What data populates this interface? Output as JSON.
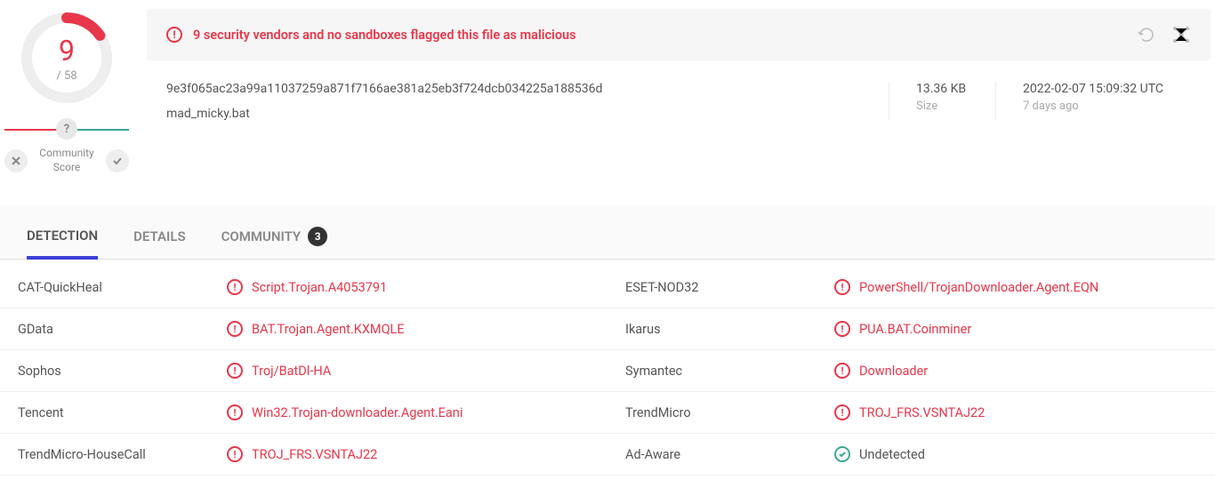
{
  "score": {
    "detections": "9",
    "total": "/ 58"
  },
  "community": {
    "help": "?",
    "label": "Community\nScore"
  },
  "banner": {
    "text": "9 security vendors and no sandboxes flagged this file as malicious"
  },
  "file": {
    "hash": "9e3f065ac23a99a11037259a871f7166ae381a25eb3f724dcb034225a188536d",
    "name": "mad_micky.bat",
    "size": "13.36 KB",
    "size_label": "Size",
    "timestamp": "2022-02-07 15:09:32 UTC",
    "rel_time": "7 days ago"
  },
  "tabs": {
    "detection": "DETECTION",
    "details": "DETAILS",
    "community": "COMMUNITY",
    "community_count": "3"
  },
  "results": [
    {
      "vendor1": "CAT-QuickHeal",
      "det1": "Script.Trojan.A4053791",
      "s1": "mal",
      "vendor2": "ESET-NOD32",
      "det2": "PowerShell/TrojanDownloader.Agent.EQN",
      "s2": "mal"
    },
    {
      "vendor1": "GData",
      "det1": "BAT.Trojan.Agent.KXMQLE",
      "s1": "mal",
      "vendor2": "Ikarus",
      "det2": "PUA.BAT.Coinminer",
      "s2": "mal"
    },
    {
      "vendor1": "Sophos",
      "det1": "Troj/BatDl-HA",
      "s1": "mal",
      "vendor2": "Symantec",
      "det2": "Downloader",
      "s2": "mal"
    },
    {
      "vendor1": "Tencent",
      "det1": "Win32.Trojan-downloader.Agent.Eani",
      "s1": "mal",
      "vendor2": "TrendMicro",
      "det2": "TROJ_FRS.VSNTAJ22",
      "s2": "mal"
    },
    {
      "vendor1": "TrendMicro-HouseCall",
      "det1": "TROJ_FRS.VSNTAJ22",
      "s1": "mal",
      "vendor2": "Ad-Aware",
      "det2": "Undetected",
      "s2": "clean"
    }
  ]
}
